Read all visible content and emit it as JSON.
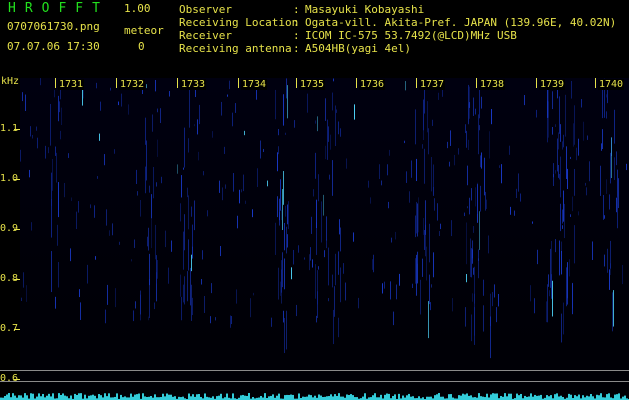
{
  "app": {
    "title": "HROFFT",
    "version": "1.00"
  },
  "file": {
    "name": "0707061730.png",
    "datetime": "07.07.06 17:30"
  },
  "meteor": {
    "label": "meteor",
    "count": "0"
  },
  "info": [
    {
      "key": "Observer",
      "value": "Masayuki Kobayashi"
    },
    {
      "key": "Receiving Location",
      "value": "Ogata-vill. Akita-Pref. JAPAN (139.96E, 40.02N)"
    },
    {
      "key": "Receiver",
      "value": "ICOM IC-575 53.7492(@LCD)MHz USB"
    },
    {
      "key": "Receiving antenna",
      "value": "A504HB(yagi 4el)"
    }
  ],
  "axis": {
    "unit": "kHz",
    "y_labels": [
      "1.1",
      "1.0",
      "0.9",
      "0.8",
      "0.7",
      "0.6"
    ],
    "time_labels": [
      "1731",
      "1732",
      "1733",
      "1734",
      "1735",
      "1736",
      "1737",
      "1738",
      "1739",
      "1740"
    ]
  },
  "colors": {
    "text": "#e6e24a",
    "title": "#22e01e",
    "signal": "#2f5cff",
    "trace": "#3cf0ff"
  }
}
